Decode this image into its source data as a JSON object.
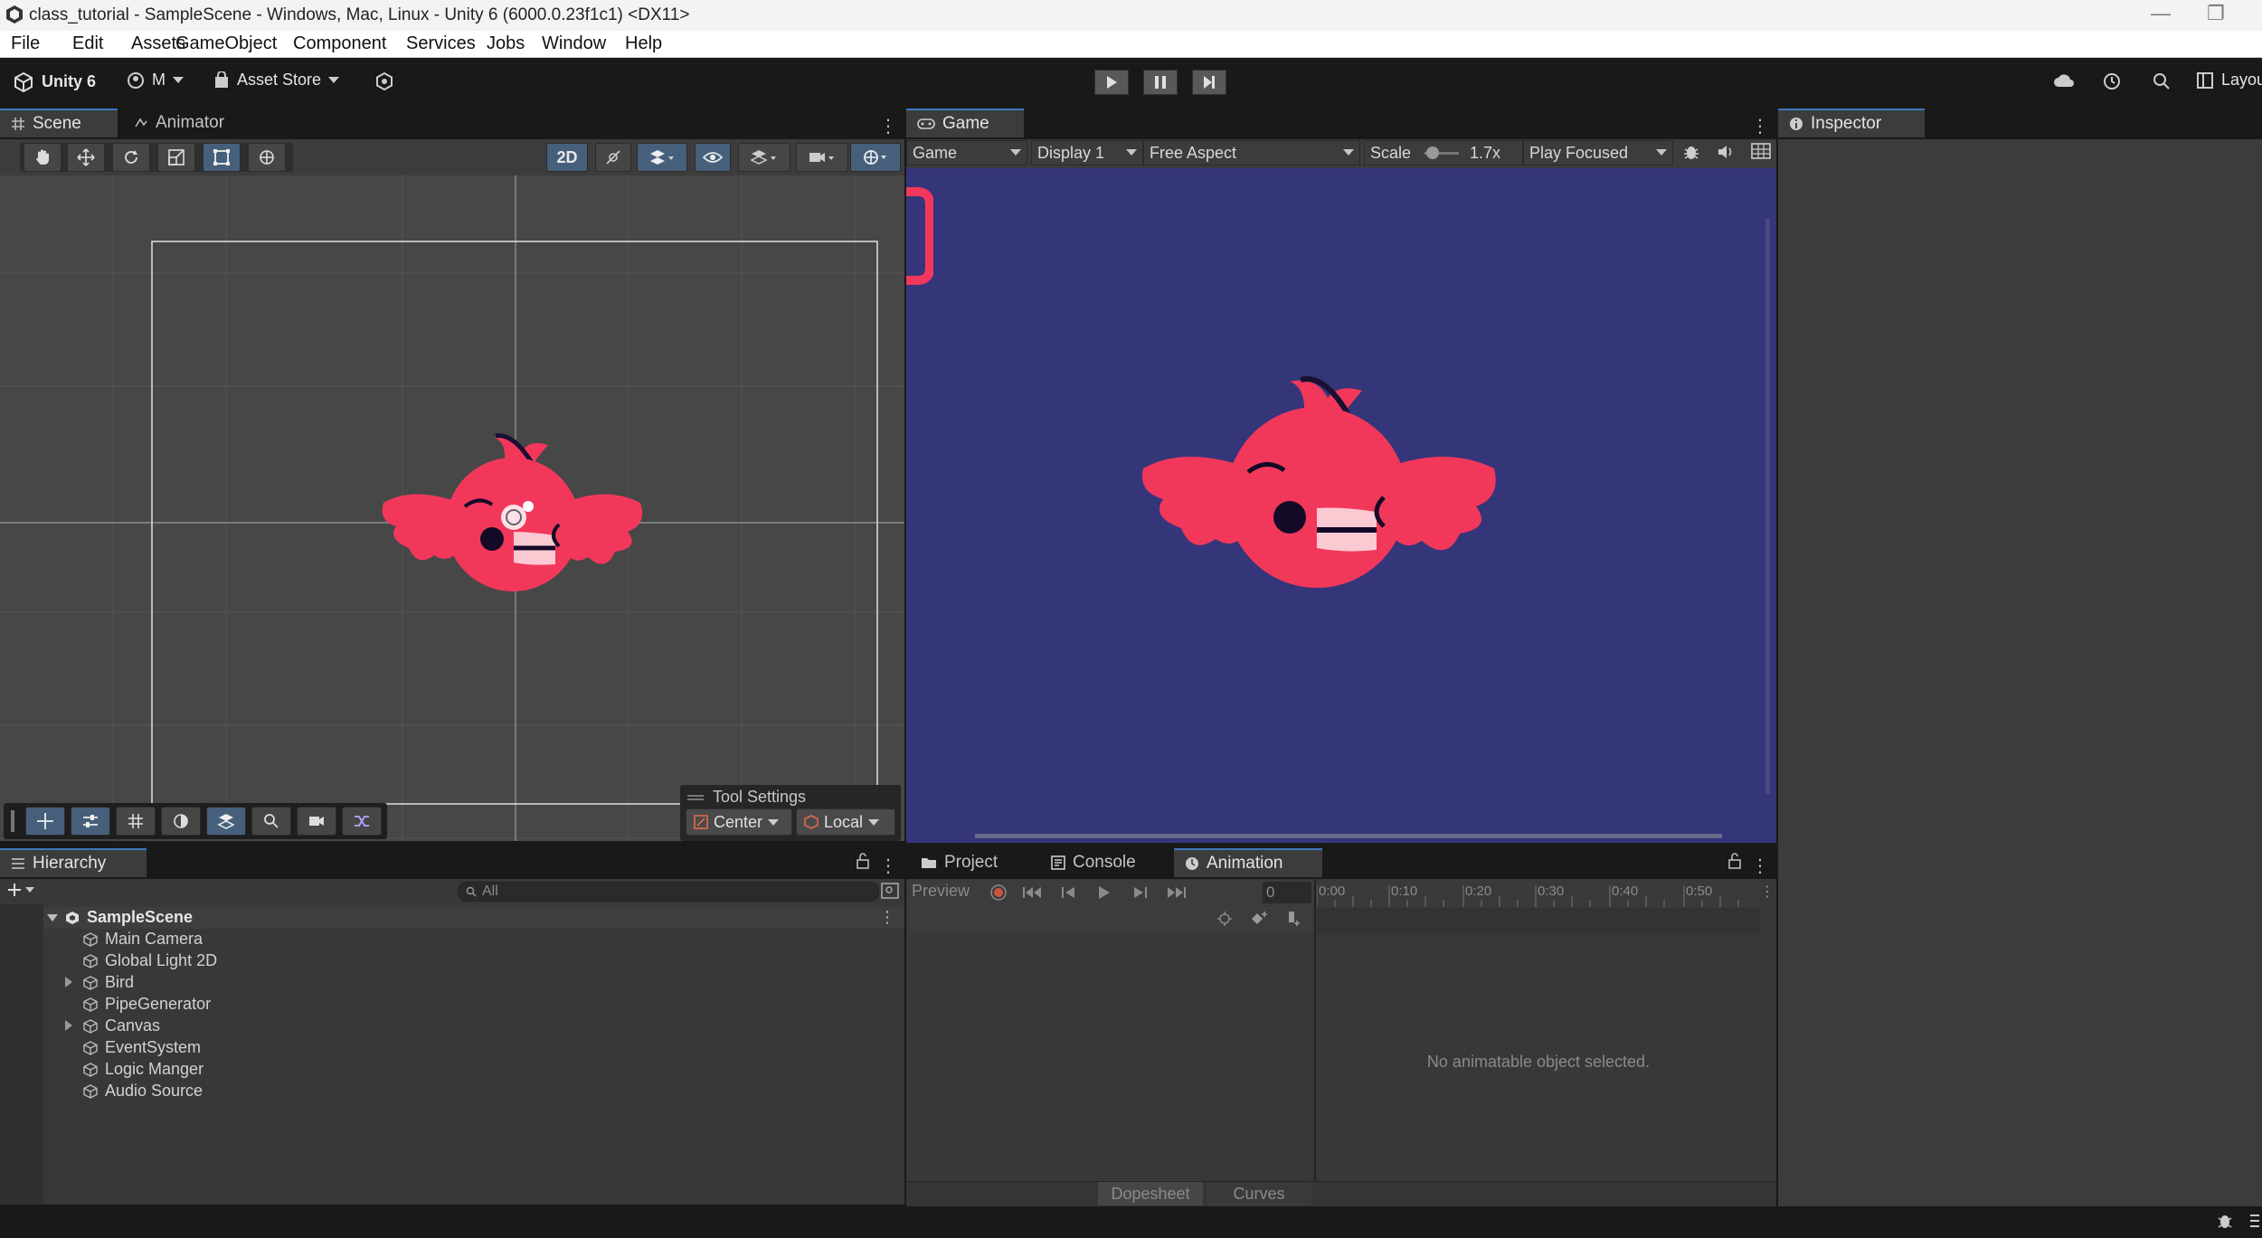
{
  "window": {
    "title": "class_tutorial - SampleScene - Windows, Mac, Linux - Unity 6 (6000.0.23f1c1) <DX11>"
  },
  "menu": [
    "File",
    "Edit",
    "Assets",
    "GameObject",
    "Component",
    "Services",
    "Jobs",
    "Window",
    "Help"
  ],
  "toolbar": {
    "product": "Unity 6",
    "account": "M",
    "asset_store": "Asset Store",
    "layout": "Layou"
  },
  "scene_panel": {
    "tabs": [
      "Scene",
      "Animator"
    ],
    "mode_2d": "2D",
    "tool_settings_title": "Tool Settings",
    "pivot": "Center",
    "space": "Local"
  },
  "game_panel": {
    "tab": "Game",
    "view": "Game",
    "display": "Display 1",
    "aspect": "Free Aspect",
    "scale_label": "Scale",
    "scale_value": "1.7x",
    "play_mode": "Play Focused",
    "colors": {
      "background": "#35357a",
      "bird": "#f2385a"
    }
  },
  "inspector": {
    "tab": "Inspector"
  },
  "hierarchy": {
    "tab": "Hierarchy",
    "search_placeholder": "All",
    "scene": "SampleScene",
    "items": [
      {
        "label": "Main Camera",
        "expandable": false
      },
      {
        "label": "Global Light 2D",
        "expandable": false
      },
      {
        "label": "Bird",
        "expandable": true
      },
      {
        "label": "PipeGenerator",
        "expandable": false
      },
      {
        "label": "Canvas",
        "expandable": true
      },
      {
        "label": "EventSystem",
        "expandable": false
      },
      {
        "label": "Logic Manger",
        "expandable": false
      },
      {
        "label": "Audio Source",
        "expandable": false
      }
    ]
  },
  "bottom_panel": {
    "tabs": [
      "Project",
      "Console",
      "Animation"
    ],
    "preview": "Preview",
    "frame": "0",
    "timeline_ticks": [
      "0:00",
      "0:10",
      "0:20",
      "0:30",
      "0:40",
      "0:50"
    ],
    "empty_message": "No animatable object selected.",
    "dopesheet": "Dopesheet",
    "curves": "Curves"
  }
}
